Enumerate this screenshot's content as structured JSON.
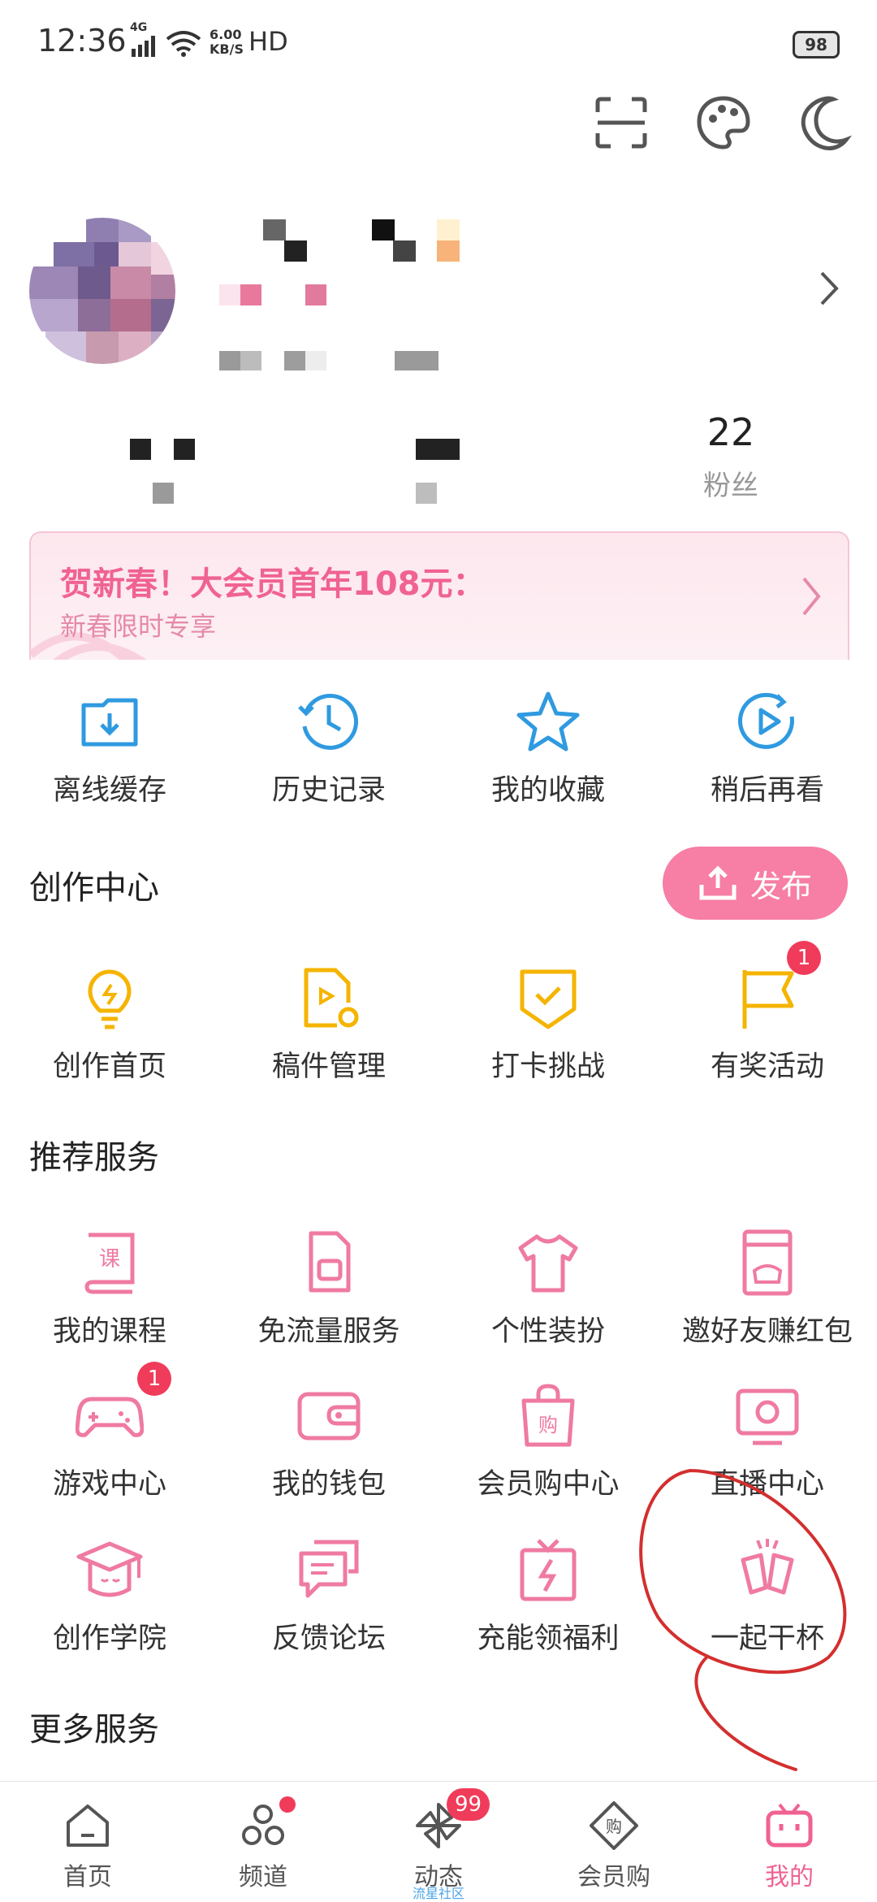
{
  "status_bar": {
    "time": "12:36",
    "signal": "4G",
    "net_speed_value": "6.00",
    "net_speed_unit": "KB/S",
    "hd": "HD",
    "battery": "98"
  },
  "top_actions": [
    "scan-icon",
    "palette-icon",
    "moon-icon"
  ],
  "profile": {
    "fans_count": "22",
    "fans_label": "粉丝"
  },
  "vip_banner": {
    "title": "贺新春！大会员首年108元：",
    "subtitle": "新春限时专享"
  },
  "quick_actions": [
    {
      "label": "离线缓存",
      "icon": "download-folder-icon"
    },
    {
      "label": "历史记录",
      "icon": "history-clock-icon"
    },
    {
      "label": "我的收藏",
      "icon": "star-icon"
    },
    {
      "label": "稍后再看",
      "icon": "watch-later-icon"
    }
  ],
  "creation_center": {
    "title": "创作中心",
    "publish_label": "发布",
    "items": [
      {
        "label": "创作首页",
        "icon": "lightbulb-icon"
      },
      {
        "label": "稿件管理",
        "icon": "manuscript-icon"
      },
      {
        "label": "打卡挑战",
        "icon": "checkin-shield-icon"
      },
      {
        "label": "有奖活动",
        "icon": "flag-icon",
        "badge": "1"
      }
    ]
  },
  "recommended_services": {
    "title": "推荐服务",
    "items": [
      {
        "label": "我的课程",
        "icon": "course-book-icon"
      },
      {
        "label": "免流量服务",
        "icon": "sim-card-icon"
      },
      {
        "label": "个性装扮",
        "icon": "tshirt-icon"
      },
      {
        "label": "邀好友赚红包",
        "icon": "red-packet-icon"
      },
      {
        "label": "游戏中心",
        "icon": "gamepad-icon",
        "badge": "1"
      },
      {
        "label": "我的钱包",
        "icon": "wallet-icon"
      },
      {
        "label": "会员购中心",
        "icon": "shopping-bag-icon"
      },
      {
        "label": "直播中心",
        "icon": "live-tv-icon"
      },
      {
        "label": "创作学院",
        "icon": "graduation-cap-icon"
      },
      {
        "label": "反馈论坛",
        "icon": "chat-bubbles-icon"
      },
      {
        "label": "充能领福利",
        "icon": "gift-bolt-icon"
      },
      {
        "label": "一起干杯",
        "icon": "cheers-icon"
      }
    ]
  },
  "more_services": {
    "title": "更多服务"
  },
  "bottom_nav": {
    "items": [
      {
        "label": "首页",
        "icon": "home-icon"
      },
      {
        "label": "频道",
        "icon": "channel-icon"
      },
      {
        "label": "动态",
        "icon": "pinwheel-icon",
        "badge": "99",
        "sub": "流星社区"
      },
      {
        "label": "会员购",
        "icon": "vip-shop-icon"
      },
      {
        "label": "我的",
        "icon": "bilibili-tv-icon"
      }
    ]
  },
  "colors": {
    "accent": "#f77ea4",
    "blue_icon": "#2f9ae0",
    "yellow_icon": "#f5b400",
    "pink_icon": "#ef7aa2",
    "badge": "#f03b5a",
    "annotation": "#d32f2f"
  }
}
